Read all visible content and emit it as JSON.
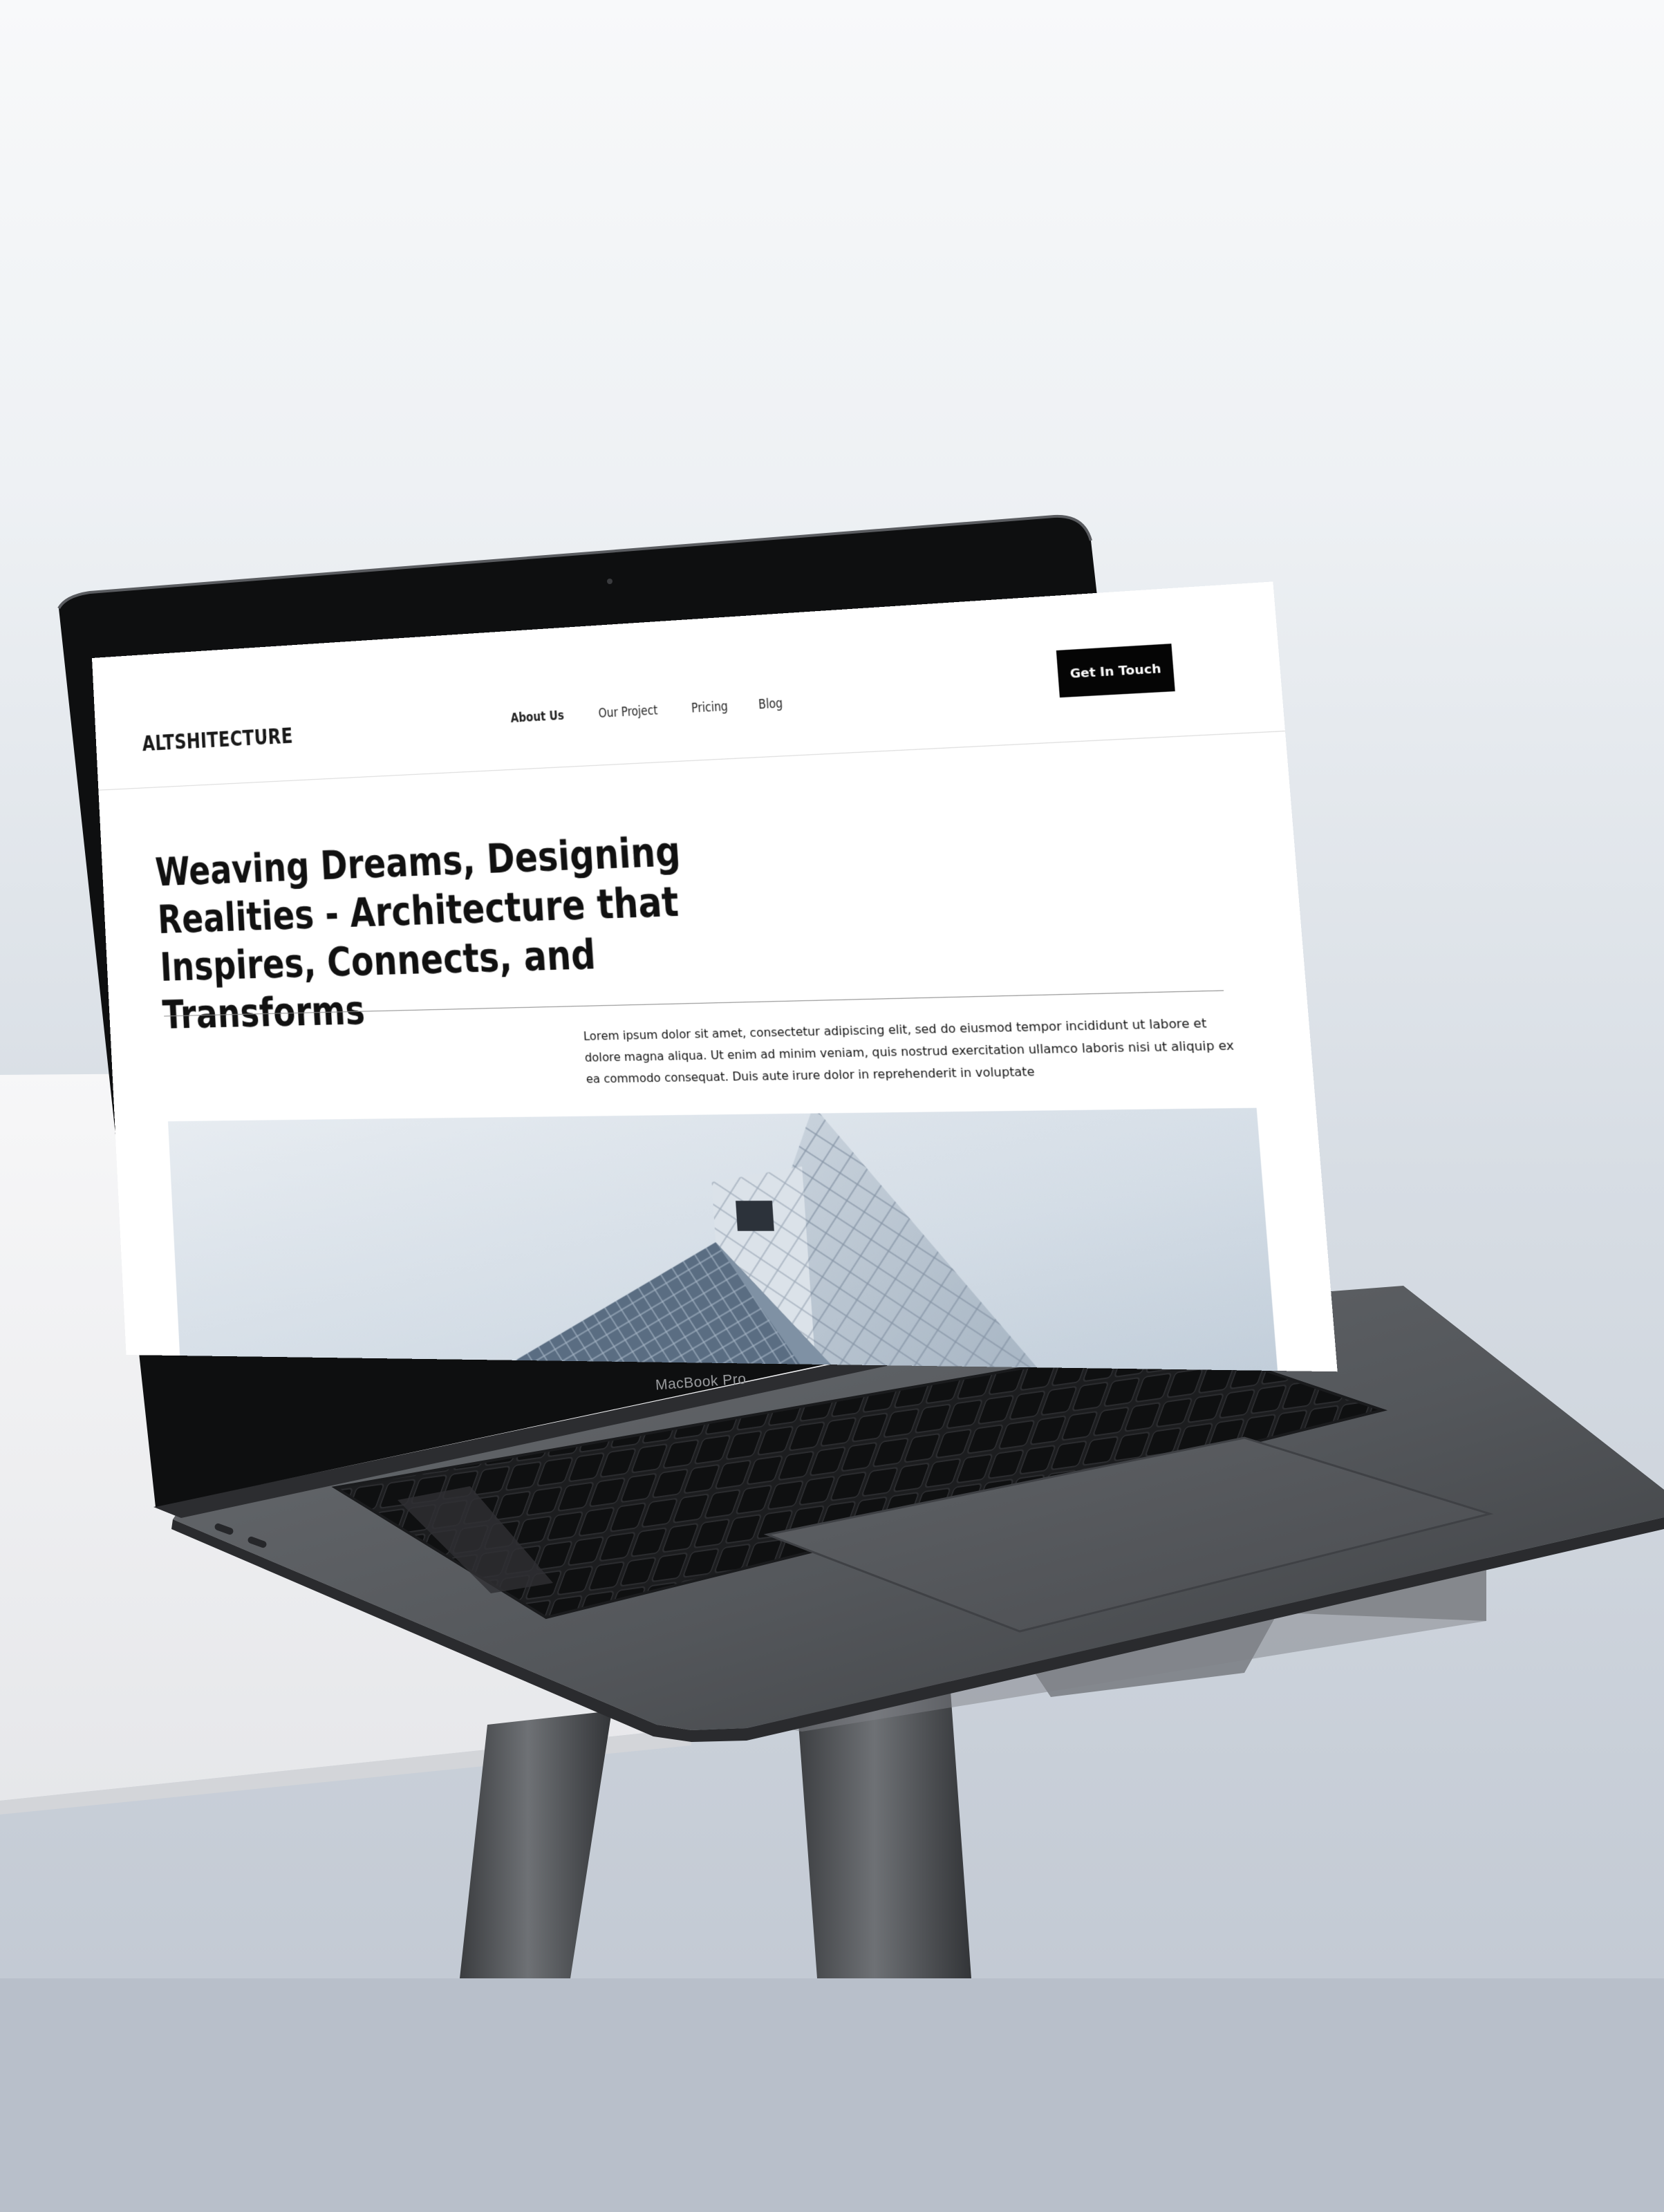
{
  "website": {
    "brand": "ALTSHITECTURE",
    "nav_items": [
      "About Us",
      "Our Project",
      "Pricing",
      "Blog"
    ],
    "cta_label": "Get In Touch",
    "headline": "Weaving Dreams, Designing Realities - Architecture that Inspires, Connects, and Transforms",
    "description": "Lorem ipsum dolor sit amet, consectetur adipiscing elit, sed do eiusmod tempor incididunt ut labore et dolore magna aliqua. Ut enim ad minim veniam, quis nostrud exercitation ullamco laboris nisi ut aliquip ex ea commodo consequat. Duis aute irure dolor in reprehenderit in voluptate"
  },
  "device": {
    "model_label": "MacBook Pro"
  },
  "colors": {
    "cta_background": "#050505",
    "laptop_body": "#5d6064",
    "page_background": "#eef1f4"
  }
}
